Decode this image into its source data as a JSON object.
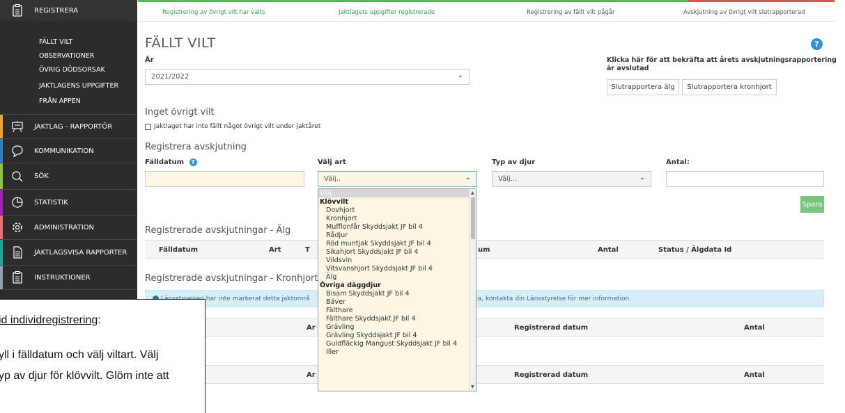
{
  "sidebar": {
    "registrera": "REGISTRERA",
    "sub_items": [
      "FÄLLT VILT",
      "OBSERVATIONER",
      "ÖVRIG DÖDSORSAK",
      "JAKTLAGENS UPPGIFTER",
      "FRÅN APPEN"
    ],
    "items": [
      {
        "label": "JAKTLAG - RAPPORTÖR",
        "color": "#e8a33d"
      },
      {
        "label": "KOMMUNIKATION",
        "color": "#3b7bbf"
      },
      {
        "label": "SÖK",
        "color": "#8bc34a"
      },
      {
        "label": "STATISTIK",
        "color": "#9c27b0"
      },
      {
        "label": "ADMINISTRATION",
        "color": "#e57373"
      },
      {
        "label": "JAKTLAGSVISA RAPPORTER",
        "color": "#26a69a"
      },
      {
        "label": "INSTRUKTIONER",
        "color": "#90a4ae"
      }
    ]
  },
  "progress": {
    "steps": [
      "Registrering av övrigt vilt har valts",
      "Jaktlagets uppgifter registrerade",
      "Registrering av fällt vilt pågår",
      "Avskjutning av övrigt vilt slutrapporterad"
    ]
  },
  "main": {
    "title": "FÄLLT VILT",
    "year_label": "År",
    "year_value": "2021/2022",
    "confirm_text_1": "Klicka här för att bekräfta att årets avskjutningsrapportering",
    "confirm_text_2": "är avslutad",
    "btn_alg": "Slutrapportera älg",
    "btn_kronhjort": "Slutrapportera kronhjort",
    "inget_title": "Inget övrigt vilt",
    "inget_checkbox": "Jaktlaget har inte fällt något övrigt vilt under jaktåret",
    "register_title": "Registrera avskjutning",
    "lbl_falldatum": "Fälldatum",
    "lbl_art": "Välj art",
    "lbl_typ": "Typ av djur",
    "lbl_antal": "Antal:",
    "art_value": "Välj..",
    "typ_value": "Välj...",
    "save": "Spara",
    "alg_section": "Registrerade avskjutningar - Älg",
    "alg_headers": [
      "Fälldatum",
      "Art",
      "T",
      "um",
      "Antal",
      "Status / Älgdata Id"
    ],
    "kron_section": "Registrerade avskjutningar - Kronhjort",
    "info_left": "Länsstyrelsen har inte markerat detta jaktområ",
    "info_right": "data, kontakta din Länsstyrelse för mer information.",
    "row3_headers": [
      "Ar",
      "Registrerad datum",
      "Antal"
    ],
    "row4_headers": [
      "Ar",
      "Registrerad datum",
      "Antal"
    ]
  },
  "dropdown": {
    "first": "Välj..",
    "groups": [
      {
        "name": "Klövvilt",
        "items": [
          "Dovhjort",
          "Kronhjort",
          "Mufflonfår Skyddsjakt JF bil 4",
          "Rådjur",
          "Röd muntjak Skyddsjakt JF bil 4",
          "Sikahjort Skyddsjakt JF bil 4",
          "Vildsvin",
          "Vitsvanshjort Skyddsjakt JF bil 4",
          "Älg"
        ]
      },
      {
        "name": "Övriga däggdjur",
        "items": [
          "Bisam Skyddsjakt JF bil 4",
          "Bäver",
          "Fälthare",
          "Fälthare Skyddsjakt JF bil 4",
          "Grävling",
          "Grävling Skyddsjakt JF bil 4",
          "Guldfläckig Mangust Skyddsjakt JF bil 4",
          "Iller"
        ]
      }
    ]
  },
  "overlay": {
    "line1": "id individregistrering",
    "line1_suffix": ":",
    "line2": "yll i fälldatum och välj viltart. Välj",
    "line3": "yp av djur för klövvilt. Glöm inte att"
  }
}
